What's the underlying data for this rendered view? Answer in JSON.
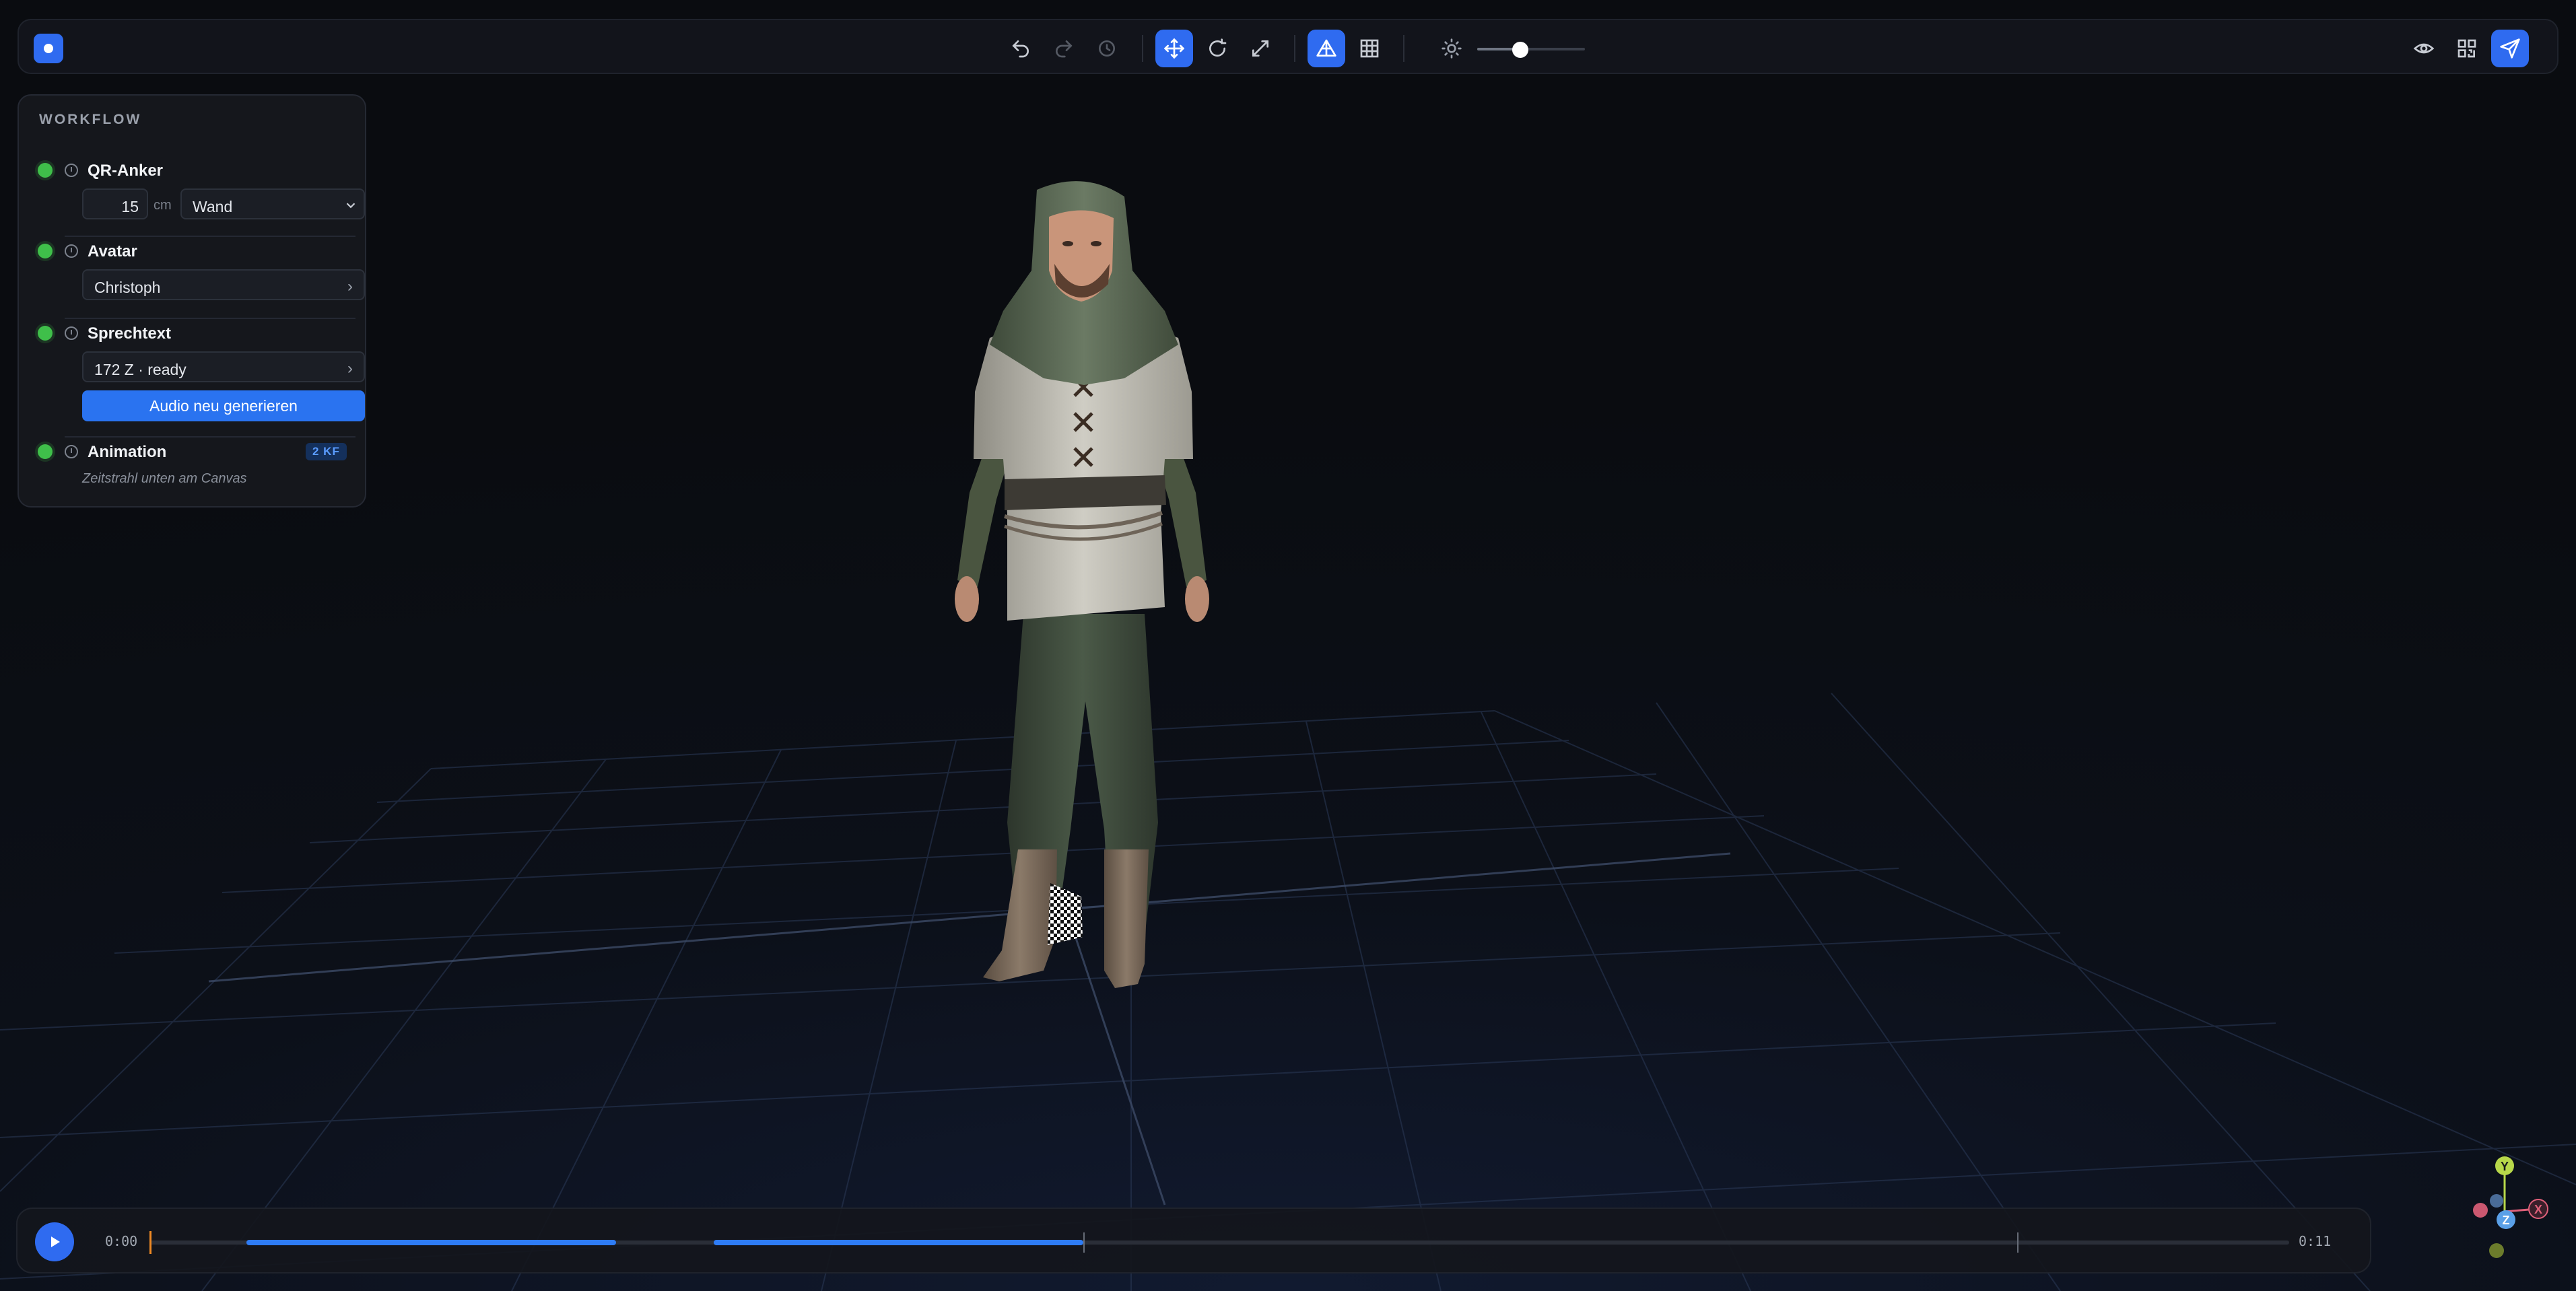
{
  "toolbar": {
    "undo_icon": "undo-icon",
    "redo_icon": "redo-icon",
    "reset_icon": "reset-history-icon",
    "move_icon": "move-icon",
    "rotate_icon": "rotate-icon",
    "scale_icon": "scale-icon",
    "render_mode_icon": "triangle-mesh-icon",
    "grid_icon": "grid-icon",
    "brightness_icon": "sun-icon",
    "brightness_level": 0.4,
    "preview_icon": "eye-icon",
    "qr_icon": "qr-code-icon",
    "publish_icon": "send-icon",
    "accent": "#2f6bf0"
  },
  "workflow": {
    "title": "WORKFLOW",
    "steps": [
      {
        "label": "QR-Anker",
        "status": "done",
        "size_value": "15",
        "size_unit": "cm",
        "surface": "Wand"
      },
      {
        "label": "Avatar",
        "status": "done",
        "value": "Christoph"
      },
      {
        "label": "Sprechtext",
        "status": "done",
        "value": "172 Z · ready",
        "action": "Audio neu generieren"
      },
      {
        "label": "Animation",
        "status": "done",
        "badge": "2 KF",
        "hint": "Zeitstrahl unten am Canvas"
      }
    ],
    "status_color": "#3fbf4a"
  },
  "timeline": {
    "start": "0:00",
    "end": "0:11",
    "duration_s": 11,
    "playhead_s": 0,
    "speech_segments_s": [
      [
        0.5,
        2.4
      ],
      [
        2.9,
        4.8
      ]
    ],
    "keyframes_s": [
      4.8,
      9.6
    ]
  },
  "gizmo": {
    "x_label": "X",
    "y_label": "Y",
    "z_label": "Z",
    "x_color": "#e0607a",
    "y_color": "#b8d84a",
    "z_color": "#5aa0e8"
  }
}
